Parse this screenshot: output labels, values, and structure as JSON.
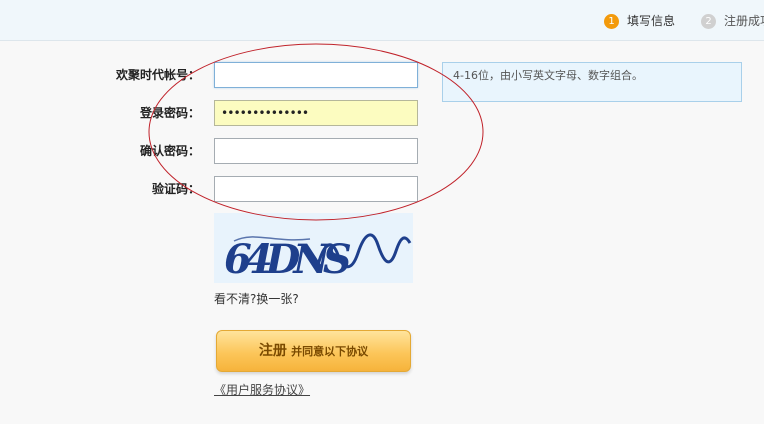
{
  "steps": [
    {
      "num": "1",
      "label": "填写信息"
    },
    {
      "num": "2",
      "label": "注册成功"
    }
  ],
  "form": {
    "account_label": "欢聚时代帐号：",
    "account_value": "",
    "password_label": "登录密码：",
    "password_mask": "••••••••••••••",
    "confirm_label": "确认密码：",
    "confirm_value": "",
    "captcha_label": "验证码：",
    "captcha_value": ""
  },
  "hint": "4-16位，由小写英文字母、数字组合。",
  "captcha": {
    "text": "64DNS",
    "refresh_prefix": "看不清?",
    "refresh_link": "换一张?"
  },
  "register_button": {
    "main": "注册",
    "sub": "并同意以下协议"
  },
  "agreement_link": "《用户服务协议》",
  "colors": {
    "step_active": "#f39a0b",
    "ellipse": "#c0222a",
    "captcha_ink": "#1e3f8c"
  }
}
